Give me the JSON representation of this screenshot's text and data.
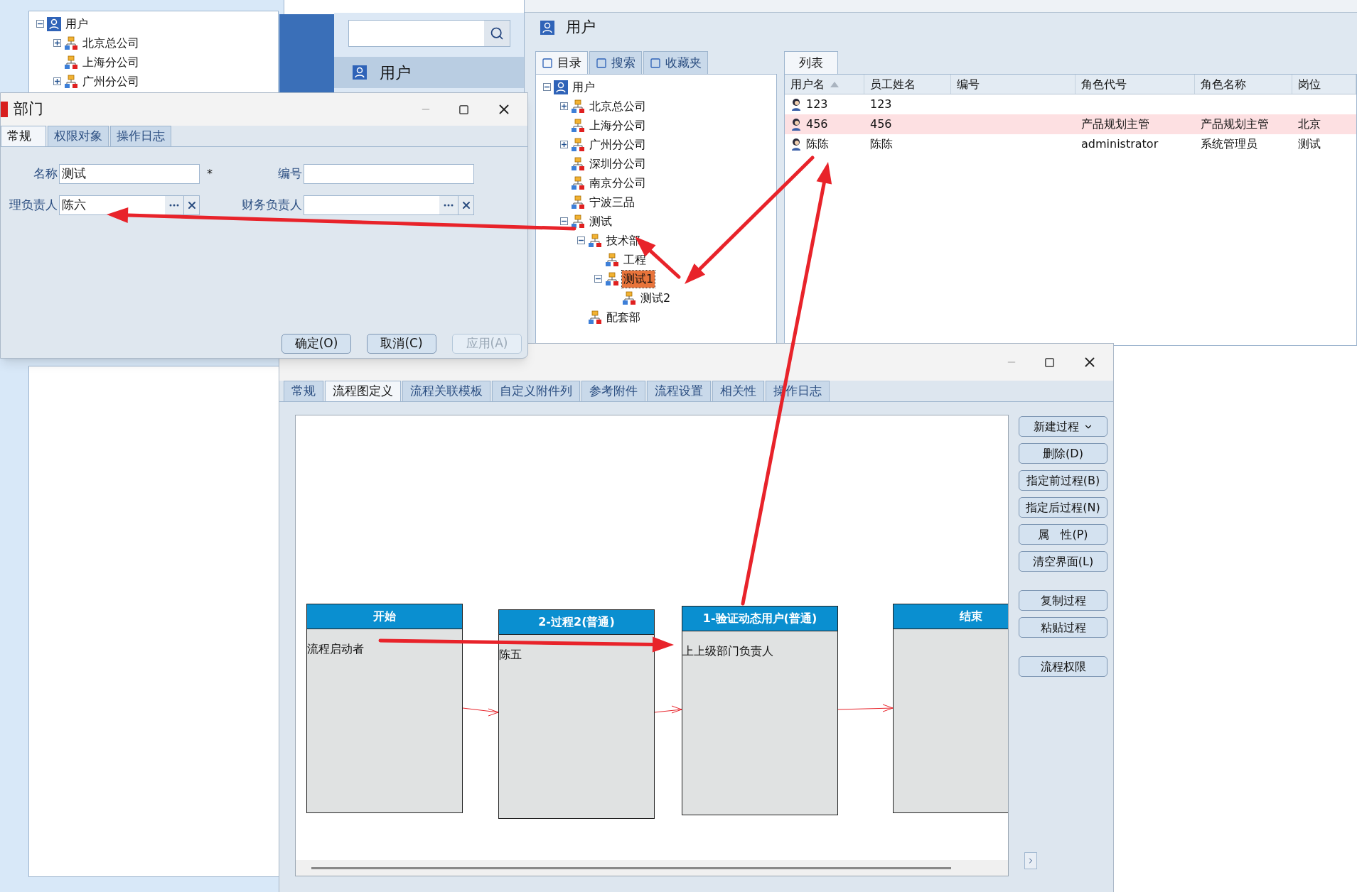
{
  "background_window": {
    "tree": [
      {
        "label": "用户",
        "kind": "root",
        "expanded": true,
        "selected": false,
        "children": [
          {
            "label": "北京总公司",
            "expanded": false,
            "selected": false
          },
          {
            "label": "上海分公司",
            "selected": false
          },
          {
            "label": "广州分公司",
            "expanded": false,
            "selected": false
          }
        ]
      }
    ],
    "search_panel": {
      "header": "用户"
    }
  },
  "department_dialog": {
    "title": "部门",
    "tabs": [
      {
        "label": "常规",
        "selected": true
      },
      {
        "label": "权限对象",
        "selected": false
      },
      {
        "label": "操作日志",
        "selected": false
      }
    ],
    "fields": [
      {
        "label": "名称",
        "value": "测试",
        "required_mark": "*",
        "kind": "text"
      },
      {
        "label": "编号",
        "kind": "text"
      },
      {
        "label": "理负责人",
        "value": "陈六",
        "kind": "picker"
      },
      {
        "label": "财务负责人",
        "kind": "picker"
      }
    ],
    "buttons": [
      {
        "label": "确定(O)",
        "disabled": false
      },
      {
        "label": "取消(C)",
        "disabled": false
      },
      {
        "label": "应用(A)",
        "disabled": true
      }
    ]
  },
  "user_window": {
    "title": "用户",
    "nav_tabs": [
      {
        "label": "目录",
        "selected": true
      },
      {
        "label": "搜索",
        "selected": false
      },
      {
        "label": "收藏夹",
        "selected": false
      }
    ],
    "tree": [
      {
        "label": "用户",
        "kind": "root",
        "expanded": true,
        "selected": false,
        "children": [
          {
            "label": "北京总公司",
            "expanded": false,
            "selected": false
          },
          {
            "label": "上海分公司",
            "selected": false
          },
          {
            "label": "广州分公司",
            "expanded": false,
            "selected": false
          },
          {
            "label": "深圳分公司",
            "selected": false
          },
          {
            "label": "南京分公司",
            "selected": false
          },
          {
            "label": "宁波三品",
            "selected": false
          },
          {
            "label": "测试",
            "expanded": true,
            "selected": false,
            "children": [
              {
                "label": "技术部",
                "expanded": true,
                "selected": false,
                "children": [
                  {
                    "label": "工程",
                    "selected": false
                  },
                  {
                    "label": "测试1",
                    "expanded": true,
                    "selected": true,
                    "children": [
                      {
                        "label": "测试2",
                        "selected": false
                      }
                    ]
                  }
                ]
              },
              {
                "label": "配套部",
                "selected": false
              }
            ]
          }
        ]
      }
    ],
    "list_tab": "列表",
    "table": {
      "columns": [
        {
          "label": "用户名",
          "sorted": true
        },
        {
          "label": "员工姓名",
          "sorted": false
        },
        {
          "label": "编号",
          "sorted": false
        },
        {
          "label": "角色代号",
          "sorted": false
        },
        {
          "label": "角色名称",
          "sorted": false
        },
        {
          "label": "岗位",
          "sorted": false
        }
      ],
      "rows": [
        {
          "selected": false,
          "cells": {
            "user_name": "123",
            "employee_name": "123"
          }
        },
        {
          "selected": true,
          "cells": {
            "user_name": "456",
            "employee_name": "456",
            "role_code": "产品规划主管",
            "role_name": "产品规划主管",
            "position": "北京"
          }
        },
        {
          "selected": false,
          "cells": {
            "user_name": "陈陈",
            "employee_name": "陈陈",
            "role_code": "administrator",
            "role_name": "系统管理员",
            "position": "测试"
          }
        }
      ]
    }
  },
  "process_window": {
    "tabs": [
      {
        "label": "常规",
        "selected": false
      },
      {
        "label": "流程图定义",
        "selected": true
      },
      {
        "label": "流程关联模板",
        "selected": false
      },
      {
        "label": "自定义附件列",
        "selected": false
      },
      {
        "label": "参考附件",
        "selected": false
      },
      {
        "label": "流程设置",
        "selected": false
      },
      {
        "label": "相关性",
        "selected": false
      },
      {
        "label": "操作日志",
        "selected": false
      }
    ],
    "nodes": [
      {
        "title": "开始",
        "body": "流程启动者"
      },
      {
        "title": "2-过程2(普通)",
        "body": "陈五"
      },
      {
        "title": "1-验证动态用户(普通)",
        "body": "上上级部门负责人"
      },
      {
        "title": "结束"
      }
    ],
    "button_groups": [
      [
        {
          "label": "新建过程",
          "dropdown": true
        },
        {
          "label": "删除(D)",
          "dropdown": false
        },
        {
          "label": "指定前过程(B)",
          "dropdown": false
        },
        {
          "label": "指定后过程(N)",
          "dropdown": false
        },
        {
          "label": "属　性(P)",
          "dropdown": false
        },
        {
          "label": "清空界面(L)",
          "dropdown": false
        }
      ],
      [
        {
          "label": "复制过程",
          "dropdown": false
        },
        {
          "label": "粘贴过程",
          "dropdown": false
        }
      ],
      [
        {
          "label": "流程权限",
          "dropdown": false
        }
      ]
    ]
  }
}
